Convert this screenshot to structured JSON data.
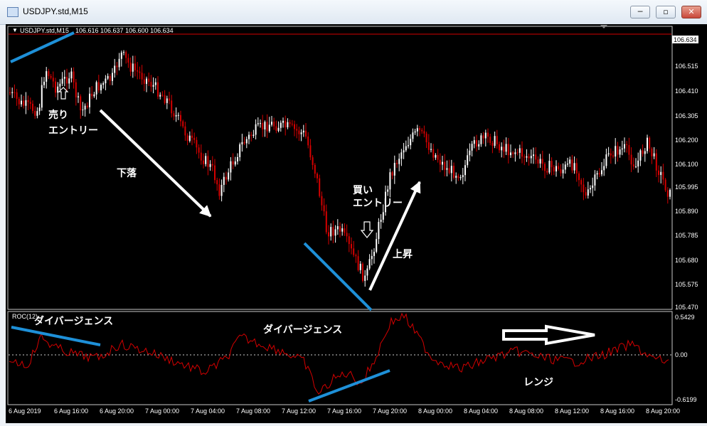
{
  "window": {
    "title": "USDJPY.std,M15",
    "buttons": {
      "minimize": "─",
      "restore": "▫",
      "close": "✕"
    },
    "icon": "chart-window-icon"
  },
  "chart": {
    "header_symbol": "USDJPY.std,M15",
    "header_prices": "106.616 106.637 106.600 106.634",
    "current_price": "106.634",
    "price_ticks": [
      "106.515",
      "106.410",
      "106.305",
      "106.200",
      "106.100",
      "105.995",
      "105.890",
      "105.785",
      "105.680",
      "105.575",
      "105.470"
    ],
    "indicator_label": "ROC(12)",
    "indicator_ticks": [
      "0.5429",
      "0.00",
      "-0.6199"
    ],
    "time_labels": [
      "6 Aug 2019",
      "6 Aug 16:00",
      "6 Aug 20:00",
      "7 Aug 00:00",
      "7 Aug 04:00",
      "7 Aug 08:00",
      "7 Aug 12:00",
      "7 Aug 16:00",
      "7 Aug 20:00",
      "8 Aug 00:00",
      "8 Aug 04:00",
      "8 Aug 08:00",
      "8 Aug 12:00",
      "8 Aug 16:00",
      "8 Aug 20:00"
    ],
    "colors": {
      "bull": "#ffffff",
      "bear": "#d40000",
      "annotation_line": "#1e90d8",
      "price_line": "#d40000",
      "roc_line": "#d40000"
    }
  },
  "annotations": {
    "sell_1": "売り",
    "sell_2": "エントリー",
    "down": "下落",
    "buy_1": "買い",
    "buy_2": "エントリー",
    "up": "上昇",
    "div_1": "ダイバージェンス",
    "div_2": "ダイバージェンス",
    "range": "レンジ"
  }
}
